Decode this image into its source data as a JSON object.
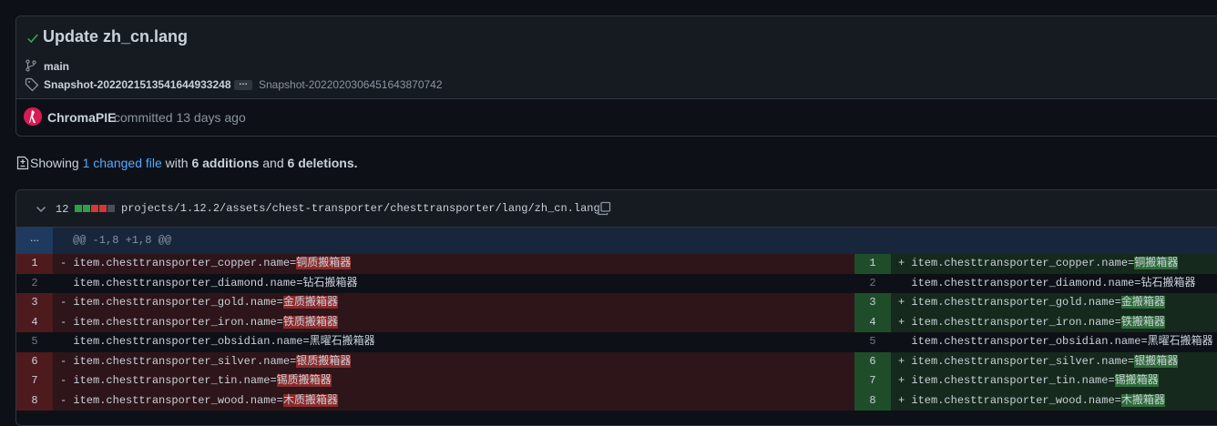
{
  "commit": {
    "title": "Update zh_cn.lang",
    "branch": "main",
    "tag": "Snapshot-20220215135416449332​48",
    "ellipsis": "…",
    "tag2": "Snapshot-20220203064516438707​42",
    "author": "ChromaPIE",
    "committed_text": "committed 13 days ago"
  },
  "summary": {
    "prefix": "Showing",
    "changed_link": "1 changed file",
    "with": "with",
    "additions": "6 additions",
    "and": "and",
    "deletions": "6 deletions",
    "period": "."
  },
  "file": {
    "change_count": "12",
    "path": "projects/1.12.2/assets/chest-transporter/chesttransporter/lang/zh_cn.lang",
    "stat_colors": [
      "#2ea043",
      "#2ea043",
      "#da3633",
      "#da3633",
      "#484f58"
    ]
  },
  "hunk": {
    "expand_label": "...",
    "header": "@@ -1,8 +1,8 @@"
  },
  "diff_rows": [
    {
      "type": "change",
      "left_ln": "1",
      "left_sign": "-",
      "left_key": "item.chesttransporter_copper.name=",
      "left_val": "铜质搬箱器",
      "right_ln": "1",
      "right_sign": "+",
      "right_key": "item.chesttransporter_copper.name=",
      "right_val": "铜搬箱器"
    },
    {
      "type": "context",
      "left_ln": "2",
      "left_sign": " ",
      "left_key": "item.chesttransporter_diamond.name=",
      "left_val": "钻石搬箱器",
      "right_ln": "2",
      "right_sign": " ",
      "right_key": "item.chesttransporter_diamond.name=",
      "right_val": "钻石搬箱器"
    },
    {
      "type": "change",
      "left_ln": "3",
      "left_sign": "-",
      "left_key": "item.chesttransporter_gold.name=",
      "left_val": "金质搬箱器",
      "right_ln": "3",
      "right_sign": "+",
      "right_key": "item.chesttransporter_gold.name=",
      "right_val": "金搬箱器"
    },
    {
      "type": "change",
      "left_ln": "4",
      "left_sign": "-",
      "left_key": "item.chesttransporter_iron.name=",
      "left_val": "铁质搬箱器",
      "right_ln": "4",
      "right_sign": "+",
      "right_key": "item.chesttransporter_iron.name=",
      "right_val": "铁搬箱器"
    },
    {
      "type": "context",
      "left_ln": "5",
      "left_sign": " ",
      "left_key": "item.chesttransporter_obsidian.name=",
      "left_val": "黑曜石搬箱器",
      "right_ln": "5",
      "right_sign": " ",
      "right_key": "item.chesttransporter_obsidian.name=",
      "right_val": "黑曜石搬箱器"
    },
    {
      "type": "change",
      "left_ln": "6",
      "left_sign": "-",
      "left_key": "item.chesttransporter_silver.name=",
      "left_val": "银质搬箱器",
      "right_ln": "6",
      "right_sign": "+",
      "right_key": "item.chesttransporter_silver.name=",
      "right_val": "银搬箱器"
    },
    {
      "type": "change",
      "left_ln": "7",
      "left_sign": "-",
      "left_key": "item.chesttransporter_tin.name=",
      "left_val": "锡质搬箱器",
      "right_ln": "7",
      "right_sign": "+",
      "right_key": "item.chesttransporter_tin.name=",
      "right_val": "锡搬箱器"
    },
    {
      "type": "change",
      "left_ln": "8",
      "left_sign": "-",
      "left_key": "item.chesttransporter_wood.name=",
      "left_val": "木质搬箱器",
      "right_ln": "8",
      "right_sign": "+",
      "right_key": "item.chesttransporter_wood.name=",
      "right_val": "木搬箱器"
    }
  ]
}
